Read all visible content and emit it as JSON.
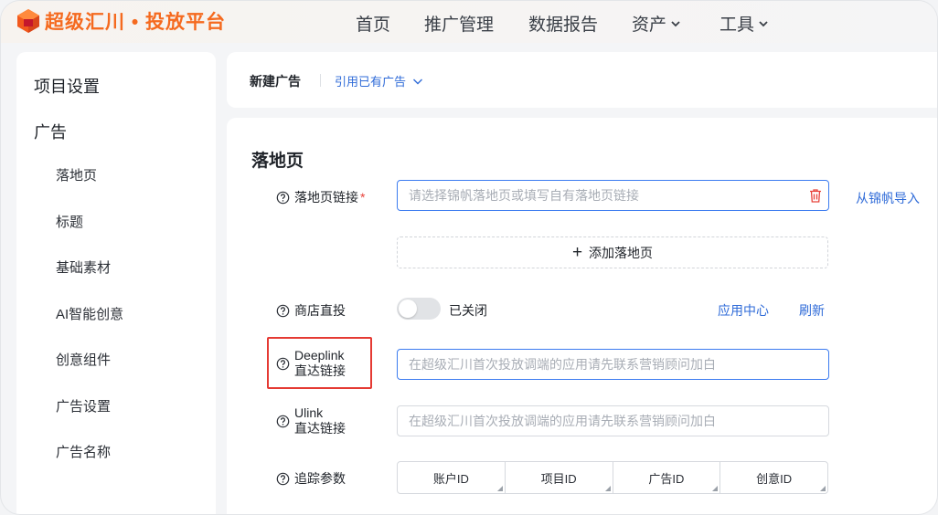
{
  "brand": {
    "name": "超级汇川 • 投放平台",
    "color": "#f56a1f"
  },
  "nav": {
    "items": [
      {
        "label": "首页",
        "has_dropdown": false
      },
      {
        "label": "推广管理",
        "has_dropdown": false
      },
      {
        "label": "数据报告",
        "has_dropdown": false
      },
      {
        "label": "资产",
        "has_dropdown": true
      },
      {
        "label": "工具",
        "has_dropdown": true
      }
    ]
  },
  "sidebar": {
    "groups": [
      {
        "label": "项目设置"
      },
      {
        "label": "广告"
      }
    ],
    "items": [
      {
        "label": "落地页"
      },
      {
        "label": "标题"
      },
      {
        "label": "基础素材"
      },
      {
        "label": "AI智能创意"
      },
      {
        "label": "创意组件"
      },
      {
        "label": "广告设置"
      },
      {
        "label": "广告名称"
      }
    ]
  },
  "header": {
    "title": "新建广告",
    "quote_link": "引用已有广告"
  },
  "section": {
    "title": "落地页",
    "landing_link": {
      "label": "落地页链接",
      "required": "*",
      "placeholder": "请选择锦帆落地页或填写自有落地页链接",
      "import_link": "从锦帆导入"
    },
    "add_landing": {
      "plus": "+",
      "label": "添加落地页"
    },
    "store": {
      "label": "商店直投",
      "state": "已关闭",
      "app_center": "应用中心",
      "refresh": "刷新"
    },
    "deeplink": {
      "label_line1": "Deeplink",
      "label_line2": "直达链接",
      "placeholder": "在超级汇川首次投放调端的应用请先联系营销顾问加白"
    },
    "ulink": {
      "label_line1": "Ulink",
      "label_line2": "直达链接",
      "placeholder": "在超级汇川首次投放调端的应用请先联系营销顾问加白"
    },
    "tracking": {
      "label": "追踪参数",
      "columns": [
        "账户ID",
        "项目ID",
        "广告ID",
        "创意ID"
      ]
    }
  },
  "colors": {
    "accent": "#2f6bd8",
    "focus_border": "#3b7bf0",
    "highlight": "#e53a33",
    "required": "#e8433b"
  }
}
